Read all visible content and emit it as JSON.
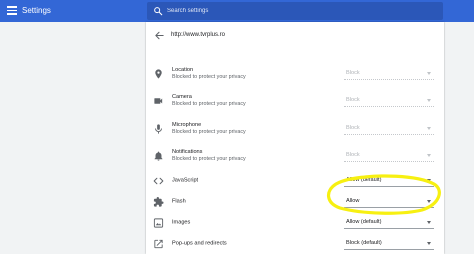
{
  "colors": {
    "toolbar": "#3367d6",
    "highlight": "#f7f011"
  },
  "header": {
    "title": "Settings",
    "menu_icon": "hamburger-menu-icon"
  },
  "search": {
    "placeholder": "Search settings",
    "icon": "search-icon"
  },
  "site": {
    "url": "http://www.tvrplus.ro",
    "back_icon": "arrow-back-icon"
  },
  "permissions": [
    {
      "label": "Location",
      "sublabel": "Blocked to protect your privacy",
      "value": "Block",
      "disabled": true,
      "icon": "location-pin-icon"
    },
    {
      "label": "Camera",
      "sublabel": "Blocked to protect your privacy",
      "value": "Block",
      "disabled": true,
      "icon": "camera-icon"
    },
    {
      "label": "Microphone",
      "sublabel": "Blocked to protect your privacy",
      "value": "Block",
      "disabled": true,
      "icon": "microphone-icon"
    },
    {
      "label": "Notifications",
      "sublabel": "Blocked to protect your privacy",
      "value": "Block",
      "disabled": true,
      "icon": "bell-icon"
    },
    {
      "label": "JavaScript",
      "value": "Allow (default)",
      "disabled": false,
      "icon": "code-icon"
    },
    {
      "label": "Flash",
      "value": "Allow",
      "disabled": false,
      "icon": "puzzle-piece-icon"
    },
    {
      "label": "Images",
      "value": "Allow (default)",
      "disabled": false,
      "icon": "image-icon"
    },
    {
      "label": "Pop-ups and redirects",
      "value": "Block (default)",
      "disabled": false,
      "icon": "open-in-new-icon"
    }
  ]
}
